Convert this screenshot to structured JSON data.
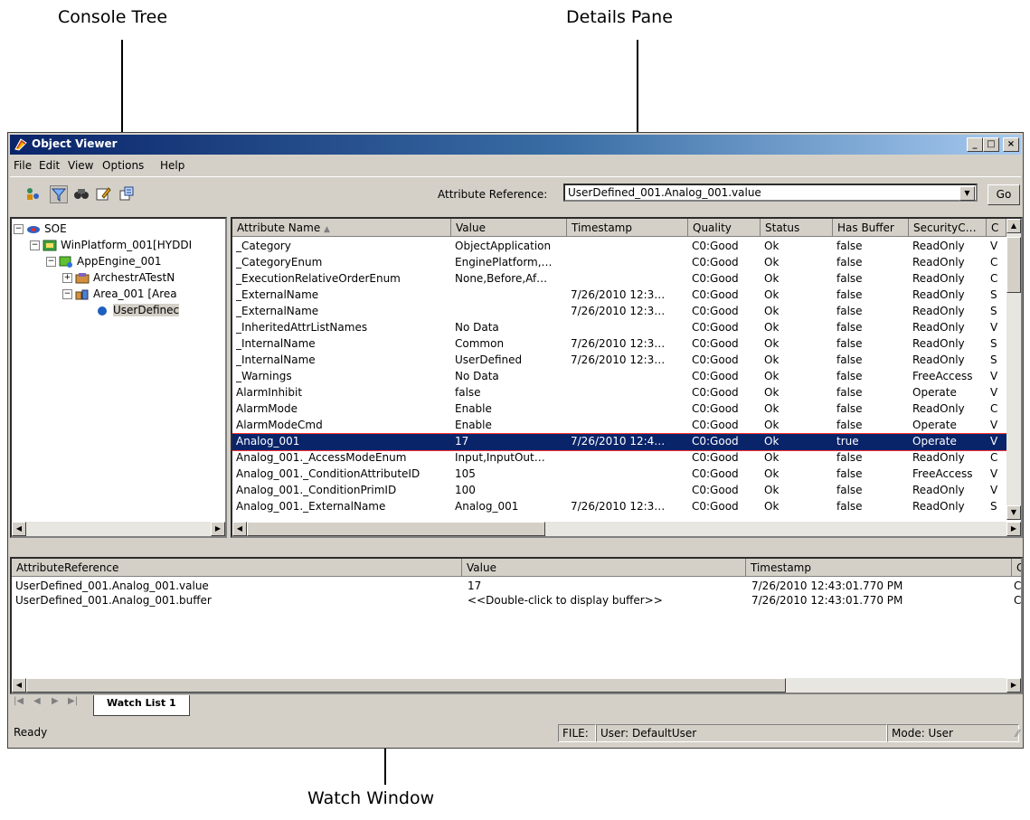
{
  "callouts": {
    "console_tree": "Console Tree",
    "details_pane": "Details Pane",
    "watch_window": "Watch Window"
  },
  "window": {
    "title": "Object Viewer",
    "min_glyph": "_",
    "max_glyph": "□",
    "close_glyph": "×"
  },
  "menu": {
    "file": "File",
    "edit": "Edit",
    "view": "View",
    "options": "Options",
    "help": "Help"
  },
  "toolbar": {
    "attr_label": "Attribute Reference:",
    "attr_value": "UserDefined_001.Analog_001.value",
    "go_label": "Go",
    "icons": [
      "connect-icon",
      "filter-icon",
      "find-icon",
      "edit-icon",
      "properties-icon"
    ]
  },
  "tree": {
    "items": [
      {
        "label": "SOE",
        "sign": "−"
      },
      {
        "label": "WinPlatform_001[HYDDI",
        "sign": "−"
      },
      {
        "label": "AppEngine_001",
        "sign": "−"
      },
      {
        "label": "ArchestrATestN",
        "sign": "+"
      },
      {
        "label": "Area_001 [Area",
        "sign": "−"
      },
      {
        "label": "UserDefinec",
        "sign": ""
      }
    ]
  },
  "details": {
    "columns": [
      "Attribute Name",
      "Value",
      "Timestamp",
      "Quality",
      "Status",
      "Has Buffer",
      "SecurityC…",
      "C"
    ],
    "rows": [
      [
        "_Category",
        "ObjectApplication",
        "",
        "C0:Good",
        "Ok",
        "false",
        "ReadOnly",
        "V"
      ],
      [
        "_CategoryEnum",
        "EnginePlatform,…",
        "",
        "C0:Good",
        "Ok",
        "false",
        "ReadOnly",
        "C"
      ],
      [
        "_ExecutionRelativeOrderEnum",
        "None,Before,Af…",
        "",
        "C0:Good",
        "Ok",
        "false",
        "ReadOnly",
        "C"
      ],
      [
        "_ExternalName",
        "",
        "7/26/2010 12:3…",
        "C0:Good",
        "Ok",
        "false",
        "ReadOnly",
        "S"
      ],
      [
        "_ExternalName",
        "",
        "7/26/2010 12:3…",
        "C0:Good",
        "Ok",
        "false",
        "ReadOnly",
        "S"
      ],
      [
        "_InheritedAttrListNames",
        "No Data",
        "",
        "C0:Good",
        "Ok",
        "false",
        "ReadOnly",
        "V"
      ],
      [
        "_InternalName",
        "Common",
        "7/26/2010 12:3…",
        "C0:Good",
        "Ok",
        "false",
        "ReadOnly",
        "S"
      ],
      [
        "_InternalName",
        "UserDefined",
        "7/26/2010 12:3…",
        "C0:Good",
        "Ok",
        "false",
        "ReadOnly",
        "S"
      ],
      [
        "_Warnings",
        "No Data",
        "",
        "C0:Good",
        "Ok",
        "false",
        "FreeAccess",
        "V"
      ],
      [
        "AlarmInhibit",
        "false",
        "",
        "C0:Good",
        "Ok",
        "false",
        "Operate",
        "V"
      ],
      [
        "AlarmMode",
        "Enable",
        "",
        "C0:Good",
        "Ok",
        "false",
        "ReadOnly",
        "C"
      ],
      [
        "AlarmModeCmd",
        "Enable",
        "",
        "C0:Good",
        "Ok",
        "false",
        "Operate",
        "V"
      ],
      [
        "Analog_001",
        "17",
        "7/26/2010 12:4…",
        "C0:Good",
        "Ok",
        "true",
        "Operate",
        "V"
      ],
      [
        "Analog_001._AccessModeEnum",
        "Input,InputOut…",
        "",
        "C0:Good",
        "Ok",
        "false",
        "ReadOnly",
        "C"
      ],
      [
        "Analog_001._ConditionAttributeID",
        "105",
        "",
        "C0:Good",
        "Ok",
        "false",
        "FreeAccess",
        "V"
      ],
      [
        "Analog_001._ConditionPrimID",
        "100",
        "",
        "C0:Good",
        "Ok",
        "false",
        "ReadOnly",
        "V"
      ],
      [
        "Analog_001._ExternalName",
        "Analog_001",
        "7/26/2010 12:3…",
        "C0:Good",
        "Ok",
        "false",
        "ReadOnly",
        "S"
      ]
    ],
    "selected_row": "Analog_001"
  },
  "watch": {
    "columns": [
      "AttributeReference",
      "Value",
      "Timestamp",
      "C"
    ],
    "rows": [
      [
        "UserDefined_001.Analog_001.value",
        "17",
        "7/26/2010 12:43:01.770 PM",
        "C"
      ],
      [
        "UserDefined_001.Analog_001.buffer",
        "<<Double-click to display buffer>>",
        "7/26/2010 12:43:01.770 PM",
        "C"
      ]
    ],
    "tab_label": "Watch List 1"
  },
  "status": {
    "ready": "Ready",
    "file": "FILE:",
    "user": "User: DefaultUser",
    "mode": "Mode: User"
  }
}
